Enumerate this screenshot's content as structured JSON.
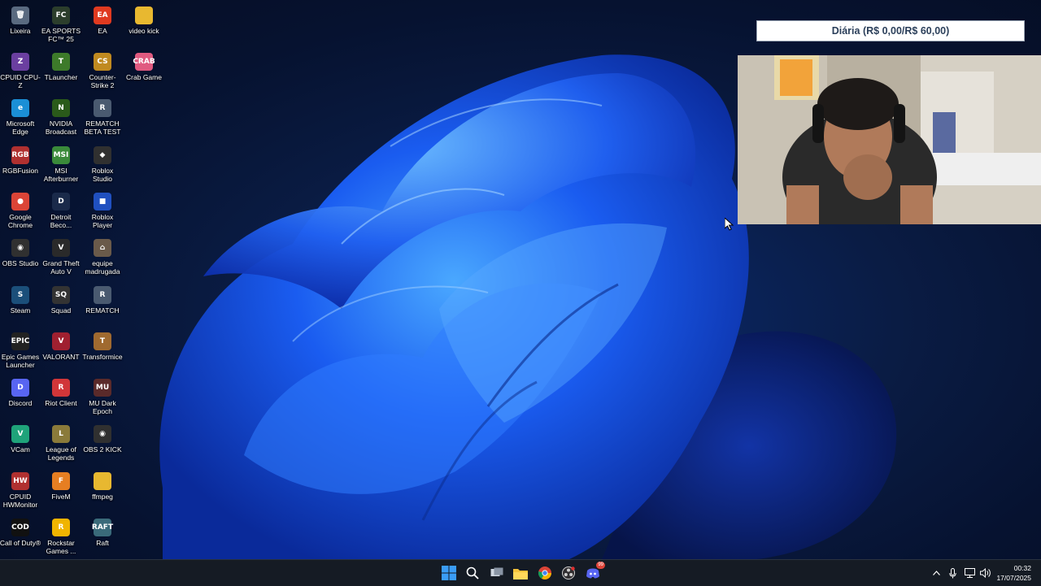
{
  "desktop": {
    "icons": [
      {
        "label": "Lixeira",
        "glyph": "🗑",
        "bg": "#5a6a80"
      },
      {
        "label": "CPUID CPU-Z",
        "glyph": "Z",
        "bg": "#6b3fa0"
      },
      {
        "label": "Microsoft Edge",
        "glyph": "e",
        "bg": "#1b8fd6"
      },
      {
        "label": "RGBFusion",
        "glyph": "RGB",
        "bg": "#b03030"
      },
      {
        "label": "Google Chrome",
        "glyph": "●",
        "bg": "#db4437"
      },
      {
        "label": "OBS Studio",
        "glyph": "◉",
        "bg": "#303030"
      },
      {
        "label": "Steam",
        "glyph": "S",
        "bg": "#1b4f7a"
      },
      {
        "label": "Epic Games Launcher",
        "glyph": "EPIC",
        "bg": "#222222"
      },
      {
        "label": "Discord",
        "glyph": "D",
        "bg": "#5865f2"
      },
      {
        "label": "VCam",
        "glyph": "V",
        "bg": "#1fa37a"
      },
      {
        "label": "CPUID HWMonitor",
        "glyph": "HW",
        "bg": "#b03030"
      },
      {
        "label": "Call of Duty®",
        "glyph": "COD",
        "bg": "#111111"
      },
      {
        "label": "EA SPORTS FC™ 25",
        "glyph": "FC",
        "bg": "#2c3e2c"
      },
      {
        "label": "TLauncher",
        "glyph": "T",
        "bg": "#3d7a2a"
      },
      {
        "label": "NVIDIA Broadcast",
        "glyph": "N",
        "bg": "#2a5a1a"
      },
      {
        "label": "MSI Afterburner",
        "glyph": "MSI",
        "bg": "#3a8a3a"
      },
      {
        "label": "Detroit Beco...",
        "glyph": "D",
        "bg": "#1a2a4a"
      },
      {
        "label": "Grand Theft Auto V",
        "glyph": "V",
        "bg": "#2a2a2a"
      },
      {
        "label": "Squad",
        "glyph": "SQ",
        "bg": "#333333"
      },
      {
        "label": "VALORANT",
        "glyph": "V",
        "bg": "#a02030"
      },
      {
        "label": "Riot Client",
        "glyph": "R",
        "bg": "#d13639"
      },
      {
        "label": "League of Legends",
        "glyph": "L",
        "bg": "#8a7a3a"
      },
      {
        "label": "FiveM",
        "glyph": "F",
        "bg": "#e67e22"
      },
      {
        "label": "Rockstar Games ...",
        "glyph": "R",
        "bg": "#f0b400"
      },
      {
        "label": "EA",
        "glyph": "EA",
        "bg": "#e03a20"
      },
      {
        "label": "Counter-Strike 2",
        "glyph": "CS",
        "bg": "#c08a20"
      },
      {
        "label": "REMATCH BETA TEST",
        "glyph": "R",
        "bg": "#4a5a70"
      },
      {
        "label": "Roblox Studio",
        "glyph": "◆",
        "bg": "#303030"
      },
      {
        "label": "Roblox Player",
        "glyph": "■",
        "bg": "#2050c0"
      },
      {
        "label": "equipe madrugada",
        "glyph": "⌂",
        "bg": "#6a5a4a"
      },
      {
        "label": "REMATCH",
        "glyph": "R",
        "bg": "#4a5a70"
      },
      {
        "label": "Transformice",
        "glyph": "T",
        "bg": "#a06a30"
      },
      {
        "label": "MU Dark Epoch",
        "glyph": "MU",
        "bg": "#5a2a2a"
      },
      {
        "label": "OBS 2 KICK",
        "glyph": "◉",
        "bg": "#303030"
      },
      {
        "label": "ffmpeg",
        "glyph": "",
        "bg": "#e8b830"
      },
      {
        "label": "Raft",
        "glyph": "RAFT",
        "bg": "#3a6a7a"
      },
      {
        "label": "video kick",
        "glyph": "",
        "bg": "#e8b830"
      },
      {
        "label": "Crab Game",
        "glyph": "CRAB",
        "bg": "#e05a80"
      }
    ]
  },
  "overlay": {
    "goal_text": "Diária (R$ 0,00/R$ 60,00)"
  },
  "taskbar": {
    "time": "00:32",
    "date": "17/07/2025",
    "discord_badge": "99"
  },
  "colors": {
    "accent": "#1e6bff",
    "taskbar_bg": "#151b24"
  }
}
